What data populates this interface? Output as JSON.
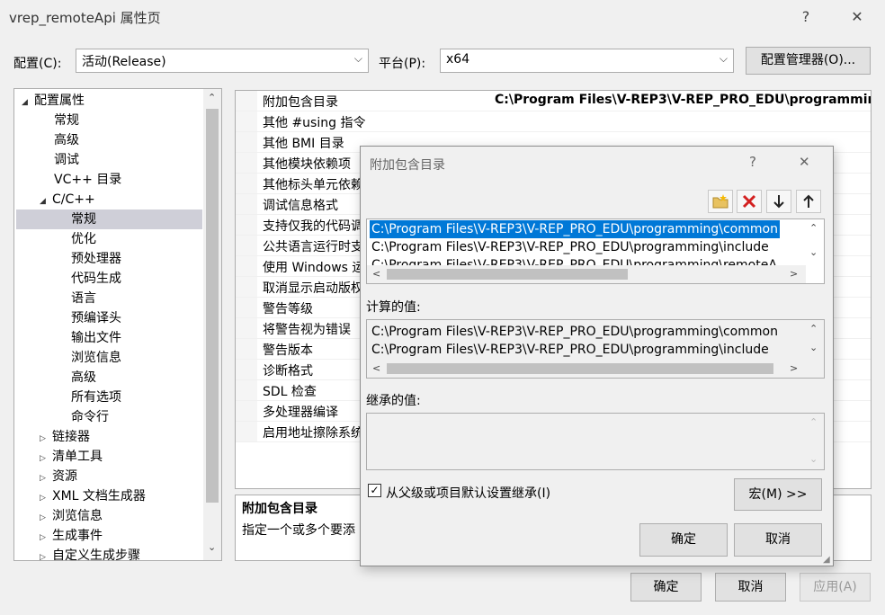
{
  "window": {
    "title": "vrep_remoteApi 属性页",
    "help_glyph": "?",
    "close_glyph": "✕"
  },
  "config_row": {
    "config_label": "配置(C):",
    "config_value": "活动(Release)",
    "platform_label": "平台(P):",
    "platform_value": "x64",
    "manager_button": "配置管理器(O)..."
  },
  "tree": {
    "items": [
      {
        "label": "配置属性"
      },
      {
        "label": "常规"
      },
      {
        "label": "高级"
      },
      {
        "label": "调试"
      },
      {
        "label": "VC++ 目录"
      },
      {
        "label": "C/C++"
      },
      {
        "label": "常规"
      },
      {
        "label": "优化"
      },
      {
        "label": "预处理器"
      },
      {
        "label": "代码生成"
      },
      {
        "label": "语言"
      },
      {
        "label": "预编译头"
      },
      {
        "label": "输出文件"
      },
      {
        "label": "浏览信息"
      },
      {
        "label": "高级"
      },
      {
        "label": "所有选项"
      },
      {
        "label": "命令行"
      },
      {
        "label": "链接器"
      },
      {
        "label": "清单工具"
      },
      {
        "label": "资源"
      },
      {
        "label": "XML 文档生成器"
      },
      {
        "label": "浏览信息"
      },
      {
        "label": "生成事件"
      },
      {
        "label": "自定义生成步骤"
      }
    ]
  },
  "properties": {
    "rows": [
      {
        "name": "附加包含目录",
        "value": "C:\\Program Files\\V-REP3\\V-REP_PRO_EDU\\programmin"
      },
      {
        "name": "其他 #using 指令",
        "value": ""
      },
      {
        "name": "其他 BMI 目录",
        "value": ""
      },
      {
        "name": "其他模块依赖项",
        "value": ""
      },
      {
        "name": "其他标头单元依赖",
        "value": ""
      },
      {
        "name": "调试信息格式",
        "value": ""
      },
      {
        "name": "支持仅我的代码调",
        "value": ""
      },
      {
        "name": "公共语言运行时支",
        "value": ""
      },
      {
        "name": "使用 Windows 运",
        "value": ""
      },
      {
        "name": "取消显示启动版权",
        "value": ""
      },
      {
        "name": "警告等级",
        "value": ""
      },
      {
        "name": "将警告视为错误",
        "value": ""
      },
      {
        "name": "警告版本",
        "value": ""
      },
      {
        "name": "诊断格式",
        "value": ""
      },
      {
        "name": "SDL 检查",
        "value": ""
      },
      {
        "name": "多处理器编译",
        "value": ""
      },
      {
        "name": "启用地址擦除系统",
        "value": ""
      }
    ],
    "desc_title": "附加包含目录",
    "desc_text": "指定一个或多个要添"
  },
  "bottom_buttons": {
    "ok": "确定",
    "cancel": "取消",
    "apply": "应用(A)"
  },
  "dialog": {
    "title": "附加包含目录",
    "help_glyph": "?",
    "close_glyph": "✕",
    "toolbar": {
      "new_folder": "new-folder-icon",
      "delete": "delete-icon",
      "move_down": "arrow-down-icon",
      "move_up": "arrow-up-icon"
    },
    "entries": [
      "C:\\Program Files\\V-REP3\\V-REP_PRO_EDU\\programming\\common",
      "C:\\Program Files\\V-REP3\\V-REP_PRO_EDU\\programming\\include",
      "C:\\Program Files\\V-REP3\\V-REP_PRO_EDU\\programming\\remoteA"
    ],
    "computed_label": "计算的值:",
    "computed": [
      "C:\\Program Files\\V-REP3\\V-REP_PRO_EDU\\programming\\common",
      "C:\\Program Files\\V-REP3\\V-REP_PRO_EDU\\programming\\include"
    ],
    "inherited_label": "继承的值:",
    "inherit_checkbox": "从父级或项目默认设置继承(I)",
    "inherit_checked": true,
    "macro_button": "宏(M) >>",
    "ok": "确定",
    "cancel": "取消"
  }
}
